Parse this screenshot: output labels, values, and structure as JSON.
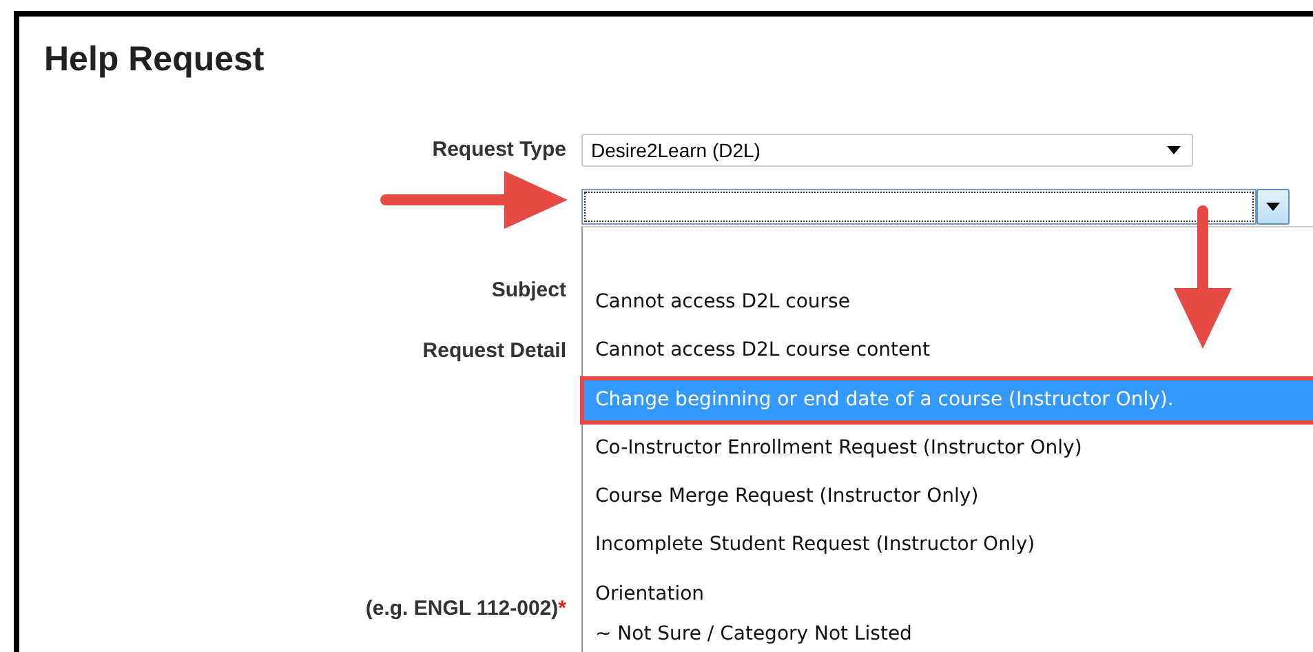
{
  "title": "Help Request",
  "labels": [
    {
      "text": "Request Type"
    },
    {
      "text": "Subject"
    },
    {
      "text": "Request Detail"
    },
    {
      "text": "(e.g. ENGL 112-002)",
      "required_mark": "*"
    }
  ],
  "request_type": {
    "value": "Desire2Learn (D2L)"
  },
  "subject": {
    "expanded": true,
    "focused": true,
    "options": [
      {
        "text": "Cannot access D2L course",
        "selected": false
      },
      {
        "text": "Cannot access D2L course content",
        "selected": false
      },
      {
        "text": "Change beginning or end date of a course (Instructor Only).",
        "selected": true
      },
      {
        "text": "Co-Instructor Enrollment Request (Instructor Only)",
        "selected": false
      },
      {
        "text": "Course Merge Request (Instructor Only)",
        "selected": false
      },
      {
        "text": "Incomplete Student Request (Instructor Only)",
        "selected": false
      },
      {
        "text": "Orientation",
        "selected": false
      },
      {
        "text": "~ Not Sure / Category Not Listed",
        "selected": false
      }
    ]
  }
}
